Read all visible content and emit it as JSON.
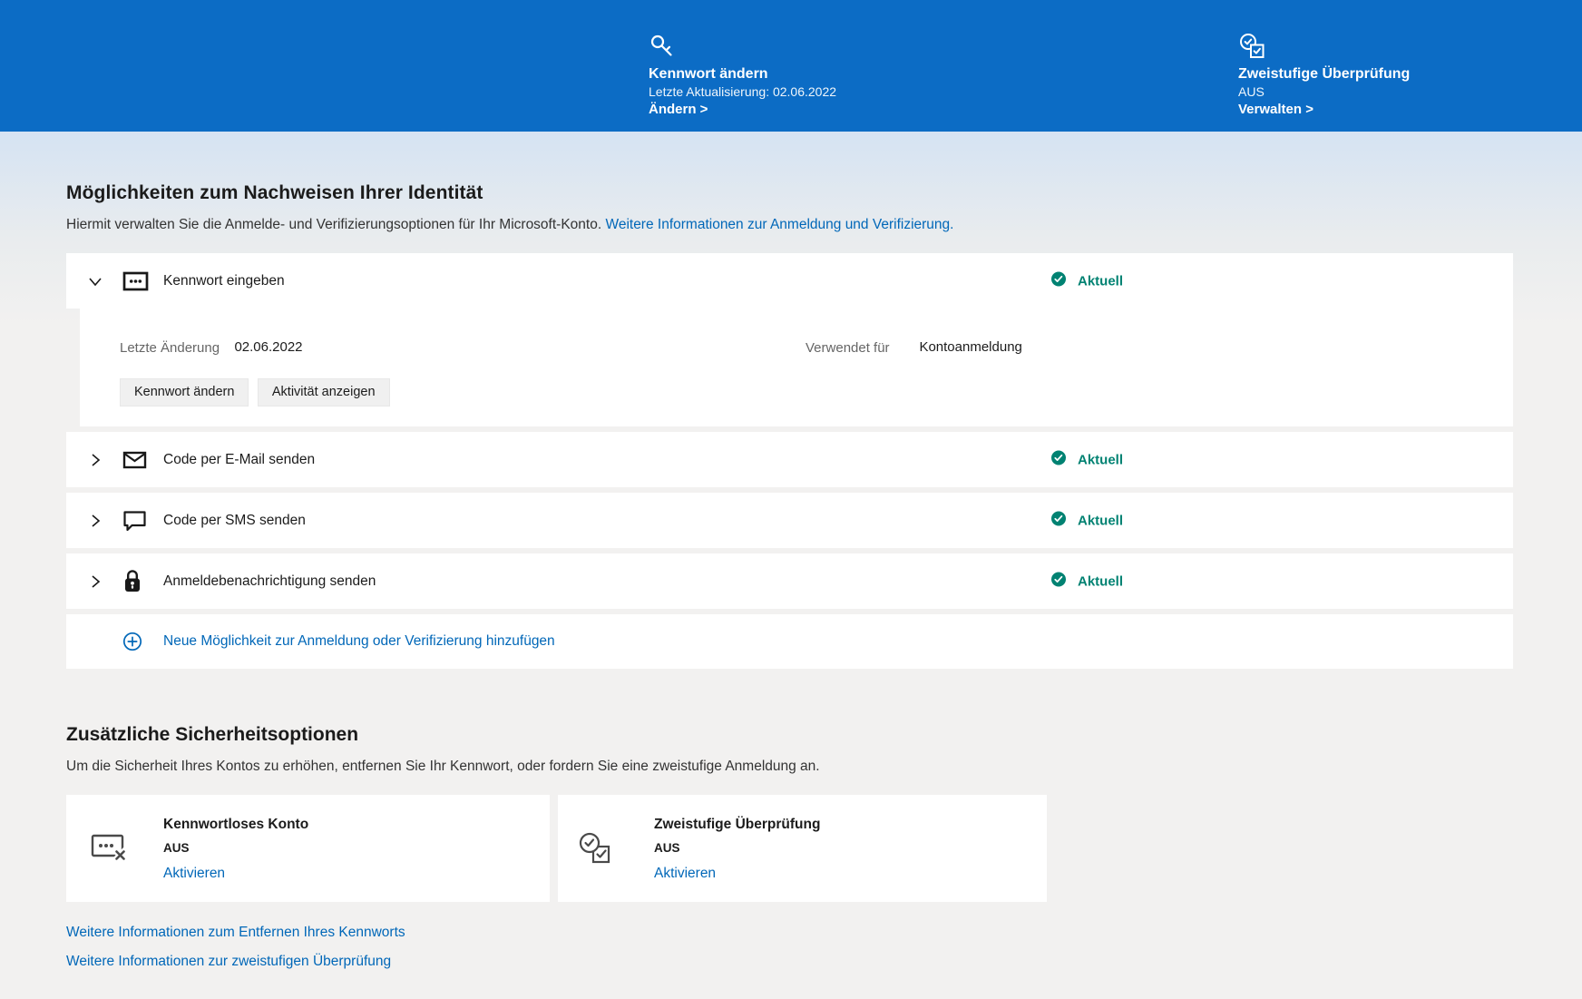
{
  "colors": {
    "header_bg": "#0c6cc5",
    "link_blue": "#0067b8",
    "status_teal": "#008272"
  },
  "header": {
    "password": {
      "title": "Kennwort ändern",
      "subtitle": "Letzte Aktualisierung: 02.06.2022",
      "action": "Ändern >"
    },
    "twostep": {
      "title": "Zweistufige Überprüfung",
      "status": "AUS",
      "action": "Verwalten >"
    }
  },
  "identity": {
    "title": "Möglichkeiten zum Nachweisen Ihrer Identität",
    "description": "Hiermit verwalten Sie die Anmelde- und Verifizierungsoptionen für Ihr Microsoft-Konto.",
    "description_link": "Weitere Informationen zur Anmeldung und Verifizierung.",
    "rows": [
      {
        "label": "Kennwort eingeben",
        "status": "Aktuell"
      },
      {
        "label": "Code per E-Mail senden",
        "status": "Aktuell",
        "value_masked": true
      },
      {
        "label": "Code per SMS senden",
        "status": "Aktuell",
        "value_masked": true
      },
      {
        "label": "Anmeldebenachrichtigung senden",
        "status": "Aktuell"
      }
    ],
    "expanded": {
      "field1_label": "Letzte Änderung",
      "field1_value": "02.06.2022",
      "field2_label": "Verwendet für",
      "field2_value": "Kontoanmeldung",
      "button1": "Kennwort ändern",
      "button2": "Aktivität anzeigen"
    },
    "add_link": "Neue Möglichkeit zur Anmeldung oder Verifizierung hinzufügen"
  },
  "security": {
    "title": "Zusätzliche Sicherheitsoptionen",
    "description": "Um die Sicherheit Ihres Kontos zu erhöhen, entfernen Sie Ihr Kennwort, oder fordern Sie eine zweistufige Anmeldung an.",
    "cards": [
      {
        "title": "Kennwortloses Konto",
        "status": "AUS",
        "action": "Aktivieren"
      },
      {
        "title": "Zweistufige Überprüfung",
        "status": "AUS",
        "action": "Aktivieren"
      }
    ],
    "links": [
      "Weitere Informationen zum Entfernen Ihres Kennworts",
      "Weitere Informationen zur zweistufigen Überprüfung"
    ]
  }
}
